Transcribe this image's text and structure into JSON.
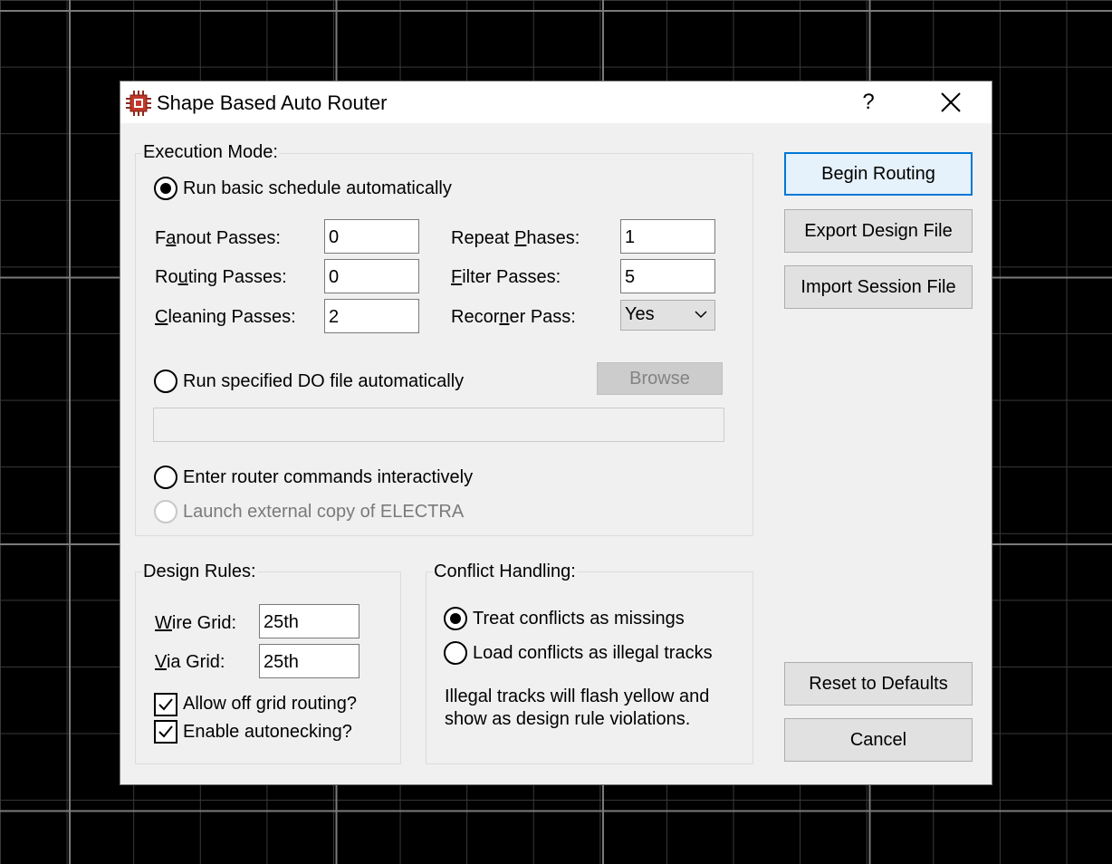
{
  "window": {
    "title": "Shape Based Auto Router",
    "help_label": "?",
    "accent_color": "#0078d7",
    "icon": "chip-icon"
  },
  "execution_mode": {
    "label": "Execution Mode:",
    "options": [
      {
        "label": "Run basic schedule automatically",
        "checked": true,
        "enabled": true
      },
      {
        "label": "Run specified DO file automatically",
        "checked": false,
        "enabled": true
      },
      {
        "label": "Enter router commands interactively",
        "checked": false,
        "enabled": true
      },
      {
        "label": "Launch external copy of ELECTRA",
        "checked": false,
        "enabled": false
      }
    ],
    "fields": {
      "fanout_passes": {
        "label": "Fanout Passes:",
        "value": "0"
      },
      "routing_passes": {
        "label": "Routing Passes:",
        "value": "0"
      },
      "cleaning_passes": {
        "label": "Cleaning Passes:",
        "value": "2"
      },
      "repeat_phases": {
        "label": "Repeat Phases:",
        "value": "1"
      },
      "filter_passes": {
        "label": "Filter Passes:",
        "value": "5"
      },
      "recorner_pass": {
        "label": "Recorner Pass:",
        "value": "Yes"
      }
    },
    "browse_label": "Browse",
    "do_file_path": ""
  },
  "design_rules": {
    "label": "Design Rules:",
    "wire_grid": {
      "label": "Wire Grid:",
      "value": "25th"
    },
    "via_grid": {
      "label": "Via Grid:",
      "value": "25th"
    },
    "allow_off_grid": {
      "label": "Allow off grid routing?",
      "checked": true
    },
    "enable_autonecking": {
      "label": "Enable autonecking?",
      "checked": true
    }
  },
  "conflict_handling": {
    "label": "Conflict Handling:",
    "options": [
      {
        "label": "Treat conflicts as missings",
        "checked": true
      },
      {
        "label": "Load conflicts as illegal tracks",
        "checked": false
      }
    ],
    "note_line1": "Illegal tracks will flash yellow and",
    "note_line2": "show as design rule violations."
  },
  "buttons": {
    "begin_routing": "Begin Routing",
    "export_design_file": "Export Design File",
    "import_session_file": "Import Session File",
    "reset_to_defaults": "Reset to Defaults",
    "cancel": "Cancel"
  }
}
